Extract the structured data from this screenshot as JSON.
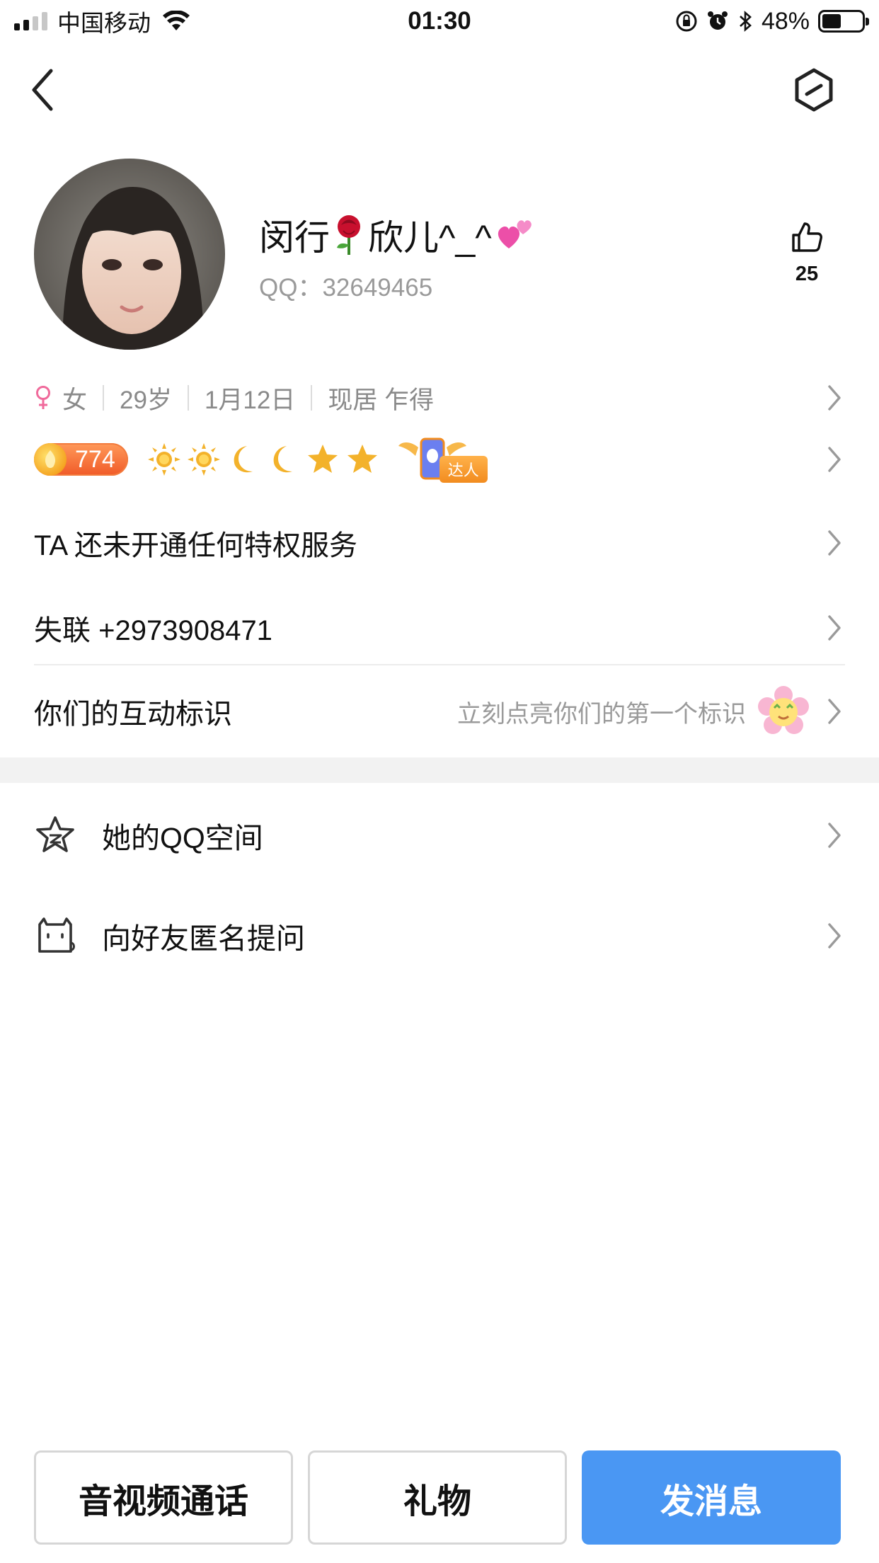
{
  "status_bar": {
    "carrier": "中国移动",
    "time": "01:30",
    "battery_pct": "48%",
    "battery_level": 0.48
  },
  "profile": {
    "nickname_part1": "闵行",
    "nickname_part2": "欣儿^_^",
    "qq": "QQ：32649465",
    "likes": "25",
    "gender": "女",
    "age": "29岁",
    "birthday": "1月12日",
    "location": "现居 乍得",
    "level": "774"
  },
  "talent_tag": "达人",
  "privilege_text": "TA 还未开通任何特权服务",
  "lost_contact_text": "失联 +2973908471",
  "interaction": {
    "label": "你们的互动标识",
    "hint": "立刻点亮你们的第一个标识"
  },
  "menu": {
    "qzone": "她的QQ空间",
    "anonymous": "向好友匿名提问"
  },
  "buttons": {
    "call": "音视频通话",
    "gift": "礼物",
    "message": "发消息"
  },
  "colors": {
    "primary": "#4a97f3",
    "gender_female": "#f06a9b",
    "level_orange": "#f05a28"
  },
  "icons": [
    "back-arrow-icon",
    "more-hexagon-icon",
    "thumbs-up-icon",
    "female-icon",
    "chevron-right-icon",
    "sun-icon",
    "moon-icon",
    "star-icon",
    "qzone-star-icon",
    "cat-box-icon",
    "rose-emoji",
    "hearts-emoji",
    "flower-emoji"
  ]
}
